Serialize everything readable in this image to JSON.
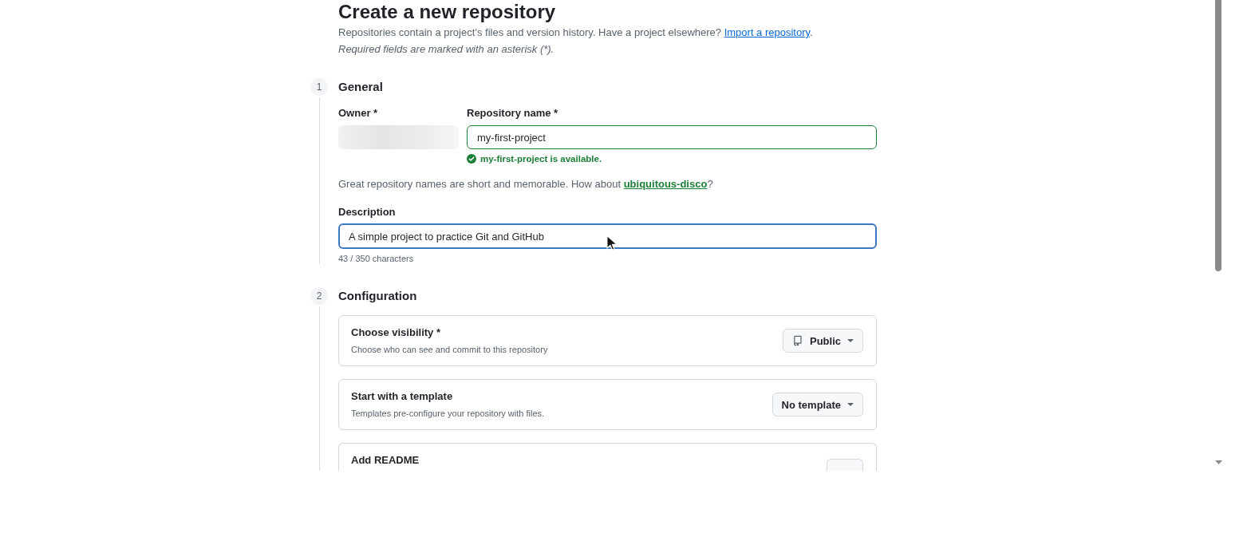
{
  "header": {
    "title": "Create a new repository",
    "intro": "Repositories contain a project’s files and version history. Have a project elsewhere?",
    "intro_link": "Import a repository",
    "intro_end": ".",
    "required_note": "Required fields are marked with an asterisk (*)."
  },
  "general": {
    "number": "1",
    "title": "General",
    "owner": {
      "label": "Owner *"
    },
    "repository_name": {
      "label": "Repository name *",
      "value": "my-first-project",
      "valid": true,
      "message": "my-first-project is available."
    },
    "suggestion": {
      "text": "Great repository names are short and memorable. How about",
      "link": "ubiquitous-disco",
      "end": "?"
    },
    "description": {
      "label": "Description",
      "value": "A simple project to practice Git and GitHub",
      "focused": true,
      "counter": "43 / 350 characters"
    }
  },
  "configuration": {
    "number": "2",
    "title": "Configuration",
    "options": [
      {
        "kind": "visibility",
        "title": "Choose visibility *",
        "subtitle": "Choose who can see and commit to this repository",
        "button": "Public"
      },
      {
        "kind": "template",
        "title": "Start with a template",
        "subtitle": "Templates pre-configure your repository with files.",
        "button": "No template"
      },
      {
        "kind": "partial",
        "title": "Add README"
      }
    ]
  }
}
